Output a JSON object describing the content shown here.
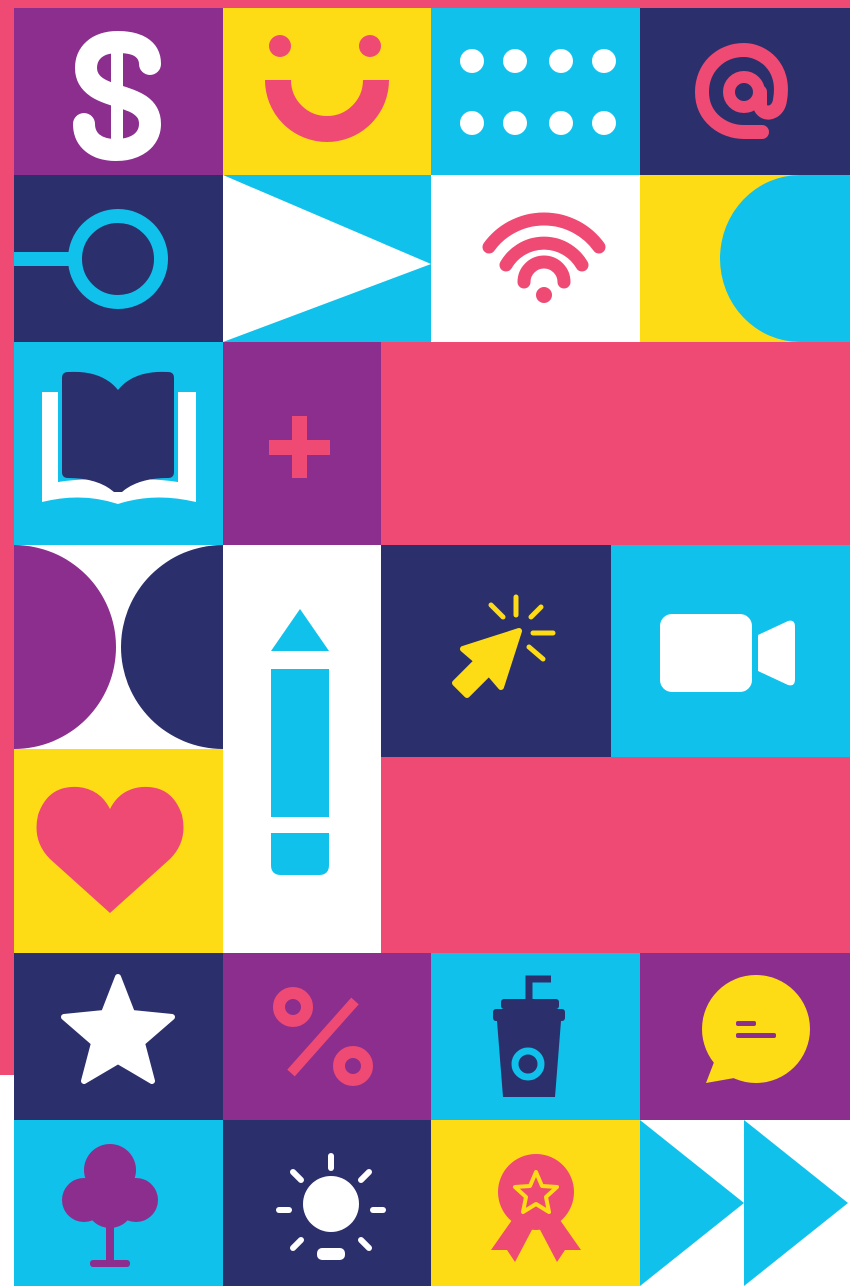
{
  "palette": {
    "pink": "#ef4a73",
    "purple": "#8b2e8e",
    "navy": "#2b2f6b",
    "cyan": "#10c1ec",
    "yellow": "#fedc15",
    "white": "#ffffff"
  },
  "tiles": [
    {
      "name": "dollar-icon"
    },
    {
      "name": "smiley-face-icon"
    },
    {
      "name": "dots-grid-icon"
    },
    {
      "name": "at-sign-icon"
    },
    {
      "name": "circle-key-shape"
    },
    {
      "name": "play-triangle-shape"
    },
    {
      "name": "wifi-icon"
    },
    {
      "name": "half-circle-shape"
    },
    {
      "name": "open-book-icon"
    },
    {
      "name": "plus-icon"
    },
    {
      "name": "pink-banner-block"
    },
    {
      "name": "half-circles-pair-shape"
    },
    {
      "name": "pencil-icon"
    },
    {
      "name": "cursor-click-icon"
    },
    {
      "name": "video-camera-icon"
    },
    {
      "name": "heart-icon"
    },
    {
      "name": "pink-banner-block-lower"
    },
    {
      "name": "star-icon"
    },
    {
      "name": "percent-icon"
    },
    {
      "name": "coffee-cup-icon"
    },
    {
      "name": "chat-bubble-icon"
    },
    {
      "name": "tree-icon"
    },
    {
      "name": "light-bulb-icon"
    },
    {
      "name": "award-badge-icon"
    },
    {
      "name": "fast-forward-shape"
    }
  ]
}
